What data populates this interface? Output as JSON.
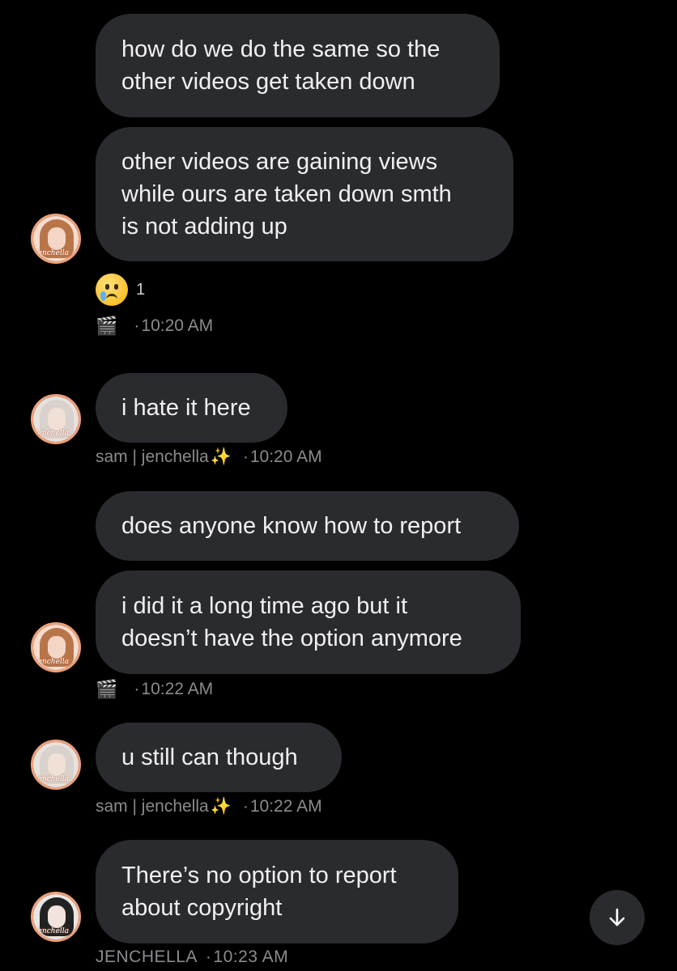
{
  "messages": [
    {
      "text": "how do we do the same so the\nother videos get taken down"
    },
    {
      "text": "other videos are gaining views\nwhile ours are taken down smth\nis not adding up"
    },
    {
      "text": "i hate it here"
    },
    {
      "text": "does anyone know how to report"
    },
    {
      "text": "i did it a long time ago but it\ndoesn’t have the option anymore"
    },
    {
      "text": "u still can though"
    },
    {
      "text": "There’s no option to report\nabout copyright"
    }
  ],
  "reaction": {
    "icon": "crying-face-emoji",
    "count": "1"
  },
  "meta": [
    {
      "icon": "clapper-board-icon",
      "sender": "",
      "time": "10:20 AM"
    },
    {
      "icon": "sparkles-icon",
      "sender": "sam | jenchella",
      "time": "10:20 AM"
    },
    {
      "icon": "clapper-board-icon",
      "sender": "",
      "time": "10:22 AM"
    },
    {
      "icon": "sparkles-icon",
      "sender": "sam | jenchella",
      "time": "10:22 AM"
    },
    {
      "icon": "",
      "sender": "JENCHELLA",
      "time": "10:23 AM"
    }
  ],
  "avatars": [
    {
      "label": "Jenchella"
    },
    {
      "label": "Jenchella"
    },
    {
      "label": "Jenchella"
    },
    {
      "label": "Jenchella"
    },
    {
      "label": "Jenchella"
    }
  ],
  "colors": {
    "background": "#000000",
    "bubble": "#2a2b2e",
    "meta_text": "#8a8b8e",
    "avatar_ring": "#f0a078"
  },
  "scroll_button": {
    "icon": "arrow-down-icon"
  }
}
